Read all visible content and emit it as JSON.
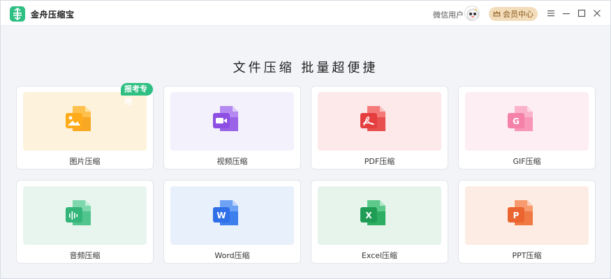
{
  "app": {
    "title": "金舟压缩宝",
    "user_name": "微信用户",
    "vip_label": "会员中心"
  },
  "headline": "文件压缩  批量超便捷",
  "cards": [
    {
      "label": "图片压缩",
      "icon": "image-file-icon",
      "bg": "#fdf3dd",
      "badge": "报考专用"
    },
    {
      "label": "视频压缩",
      "icon": "video-file-icon",
      "bg": "#f3f1fb"
    },
    {
      "label": "PDF压缩",
      "icon": "pdf-file-icon",
      "bg": "#fde9ea"
    },
    {
      "label": "GIF压缩",
      "icon": "gif-file-icon",
      "bg": "#fdeef3"
    },
    {
      "label": "音频压缩",
      "icon": "audio-file-icon",
      "bg": "#e8f5ef"
    },
    {
      "label": "Word压缩",
      "icon": "word-file-icon",
      "bg": "#e8f0fc"
    },
    {
      "label": "Excel压缩",
      "icon": "excel-file-icon",
      "bg": "#e6f4ec"
    },
    {
      "label": "PPT压缩",
      "icon": "ppt-file-icon",
      "bg": "#fdece4"
    }
  ],
  "colors": {
    "accent": "#2fbf83",
    "vip_bg": "#f3dcb9"
  }
}
